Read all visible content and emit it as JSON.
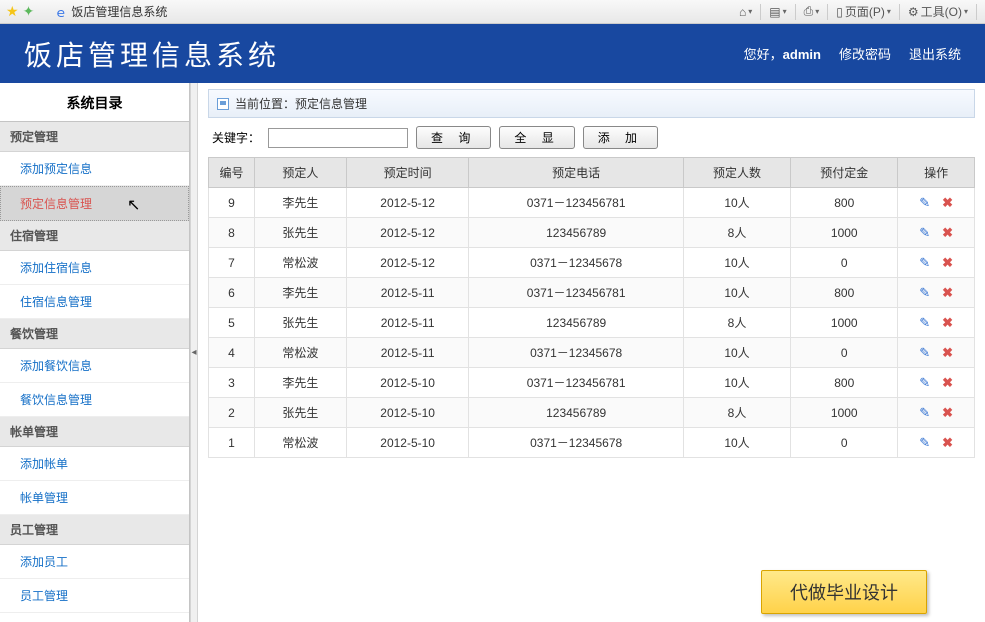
{
  "browser": {
    "tab_title": "饭店管理信息系统",
    "toolbar": {
      "home": "🏠",
      "rss": "▦",
      "print": "🖶",
      "page_label": "页面(P)",
      "tools_label": "工具(O)"
    }
  },
  "header": {
    "app_title": "饭店管理信息系统",
    "greeting_prefix": "您好，",
    "user": "admin",
    "change_pwd": "修改密码",
    "logout": "退出系统"
  },
  "sidebar": {
    "title": "系统目录",
    "groups": [
      {
        "header": "预定管理",
        "items": [
          {
            "label": "添加预定信息",
            "active": false
          },
          {
            "label": "预定信息管理",
            "active": true
          }
        ]
      },
      {
        "header": "住宿管理",
        "items": [
          {
            "label": "添加住宿信息",
            "active": false
          },
          {
            "label": "住宿信息管理",
            "active": false
          }
        ]
      },
      {
        "header": "餐饮管理",
        "items": [
          {
            "label": "添加餐饮信息",
            "active": false
          },
          {
            "label": "餐饮信息管理",
            "active": false
          }
        ]
      },
      {
        "header": "帐单管理",
        "items": [
          {
            "label": "添加帐单",
            "active": false
          },
          {
            "label": "帐单管理",
            "active": false
          }
        ]
      },
      {
        "header": "员工管理",
        "items": [
          {
            "label": "添加员工",
            "active": false
          },
          {
            "label": "员工管理",
            "active": false
          }
        ]
      }
    ]
  },
  "main": {
    "location_label": "当前位置：预定信息管理",
    "filter": {
      "keyword_label": "关键字：",
      "query_btn": "查 询",
      "showall_btn": "全  显",
      "add_btn": "添  加"
    },
    "table": {
      "headers": [
        "编号",
        "预定人",
        "预定时间",
        "预定电话",
        "预定人数",
        "预付定金",
        "操作"
      ],
      "rows": [
        {
          "id": "9",
          "name": "李先生",
          "time": "2012-5-12",
          "phone": "0371－123456781",
          "count": "10人",
          "deposit": "800"
        },
        {
          "id": "8",
          "name": "张先生",
          "time": "2012-5-12",
          "phone": "123456789",
          "count": "8人",
          "deposit": "1000"
        },
        {
          "id": "7",
          "name": "常松波",
          "time": "2012-5-12",
          "phone": "0371－12345678",
          "count": "10人",
          "deposit": "0"
        },
        {
          "id": "6",
          "name": "李先生",
          "time": "2012-5-11",
          "phone": "0371－123456781",
          "count": "10人",
          "deposit": "800"
        },
        {
          "id": "5",
          "name": "张先生",
          "time": "2012-5-11",
          "phone": "123456789",
          "count": "8人",
          "deposit": "1000"
        },
        {
          "id": "4",
          "name": "常松波",
          "time": "2012-5-11",
          "phone": "0371－12345678",
          "count": "10人",
          "deposit": "0"
        },
        {
          "id": "3",
          "name": "李先生",
          "time": "2012-5-10",
          "phone": "0371－123456781",
          "count": "10人",
          "deposit": "800"
        },
        {
          "id": "2",
          "name": "张先生",
          "time": "2012-5-10",
          "phone": "123456789",
          "count": "8人",
          "deposit": "1000"
        },
        {
          "id": "1",
          "name": "常松波",
          "time": "2012-5-10",
          "phone": "0371－12345678",
          "count": "10人",
          "deposit": "0"
        }
      ]
    }
  },
  "float_label": "代做毕业设计",
  "colors": {
    "header_bg": "#1848a0",
    "link": "#146fc7",
    "active_item": "#d9534f"
  }
}
